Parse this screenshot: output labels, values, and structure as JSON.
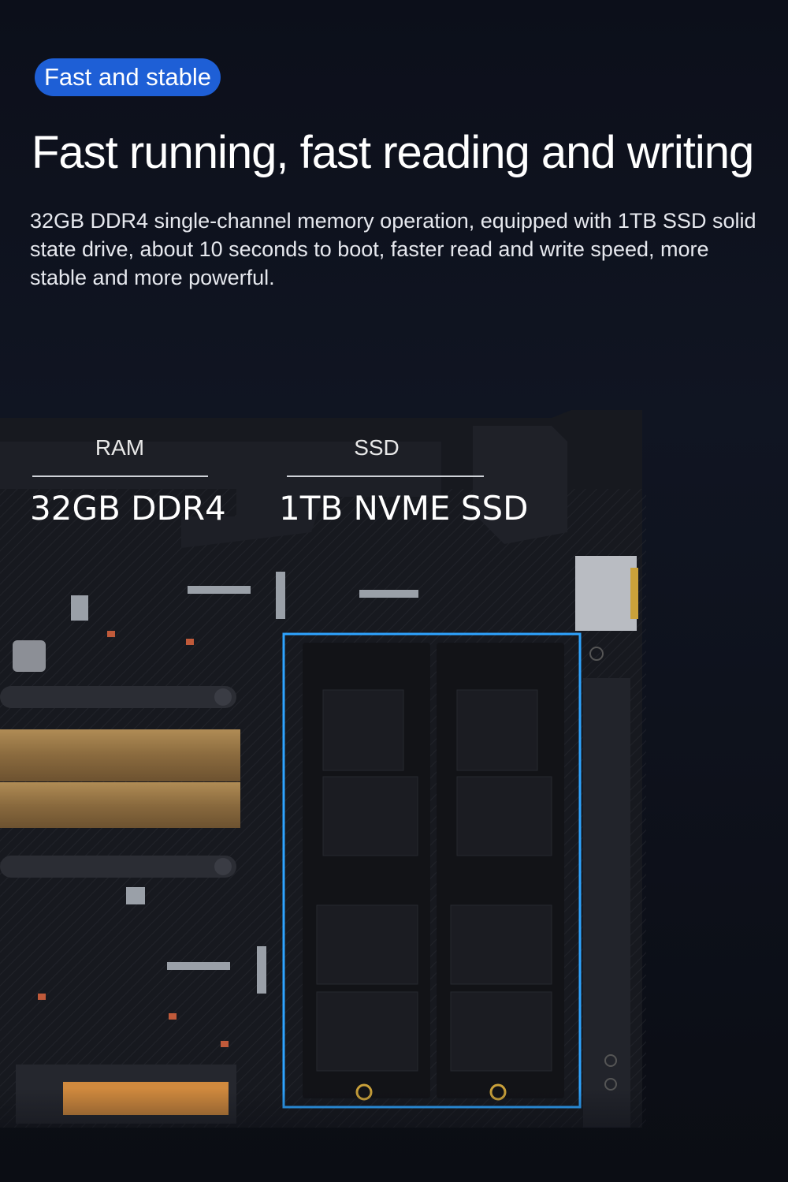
{
  "badge": {
    "label": "Fast and stable"
  },
  "headline": "Fast running, fast reading and writing",
  "description": "32GB DDR4 single-channel memory operation, equipped with 1TB SSD solid state drive, about 10 seconds to boot, faster read and write speed, more stable and more powerful.",
  "specs": [
    {
      "label": "RAM",
      "value": "32GB DDR4"
    },
    {
      "label": "SSD",
      "value": "1TB NVME SSD"
    }
  ],
  "colors": {
    "accent": "#1e5fd6",
    "highlight": "#2ea4ff",
    "copper": "#9a7a4c"
  }
}
